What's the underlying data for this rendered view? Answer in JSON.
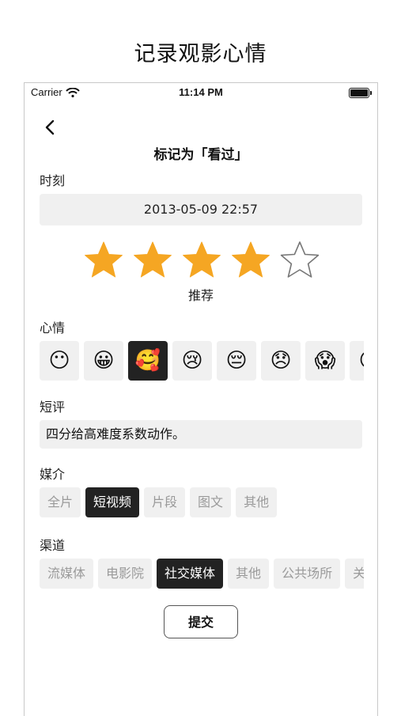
{
  "page": {
    "headline": "记录观影心情"
  },
  "status_bar": {
    "carrier": "Carrier",
    "time": "11:14 PM"
  },
  "nav": {
    "back_icon": "chevron-left-icon",
    "title": "标记为「看过」"
  },
  "time_section": {
    "label": "时刻",
    "value": "2013-05-09 22:57"
  },
  "rating": {
    "value": 4,
    "max": 5,
    "text": "推荐",
    "color": "#f5a623"
  },
  "mood_section": {
    "label": "心情",
    "items": [
      {
        "emoji": "😶"
      },
      {
        "emoji": "😀"
      },
      {
        "emoji": "🥰",
        "selected": true
      },
      {
        "emoji": "😢"
      },
      {
        "emoji": "😔"
      },
      {
        "emoji": "😞"
      },
      {
        "emoji": "😱"
      },
      {
        "emoji": "😣"
      }
    ]
  },
  "review_section": {
    "label": "短评",
    "value": "四分给高难度系数动作。"
  },
  "medium_section": {
    "label": "媒介",
    "options": [
      {
        "label": "全片"
      },
      {
        "label": "短视频",
        "selected": true
      },
      {
        "label": "片段"
      },
      {
        "label": "图文"
      },
      {
        "label": "其他"
      }
    ]
  },
  "channel_section": {
    "label": "渠道",
    "options": [
      {
        "label": "流媒体"
      },
      {
        "label": "电影院"
      },
      {
        "label": "社交媒体",
        "selected": true
      },
      {
        "label": "其他"
      },
      {
        "label": "公共场所"
      },
      {
        "label": "关"
      }
    ]
  },
  "submit_label": "提交"
}
